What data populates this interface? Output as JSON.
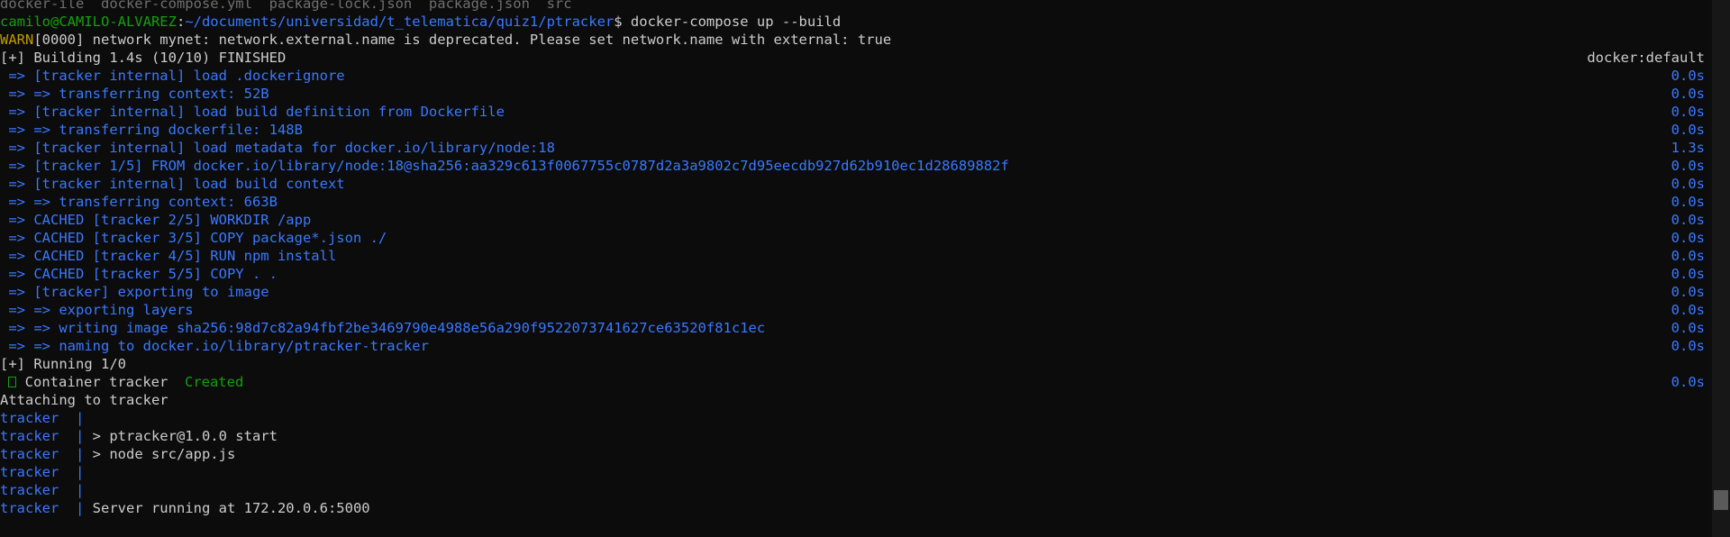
{
  "terminal": {
    "top_partial": "docker-ile  docker-compose.yml  package-lock.json  package.json  src",
    "prompt": {
      "user_host": "camilo@CAMILO-ALVAREZ",
      "path": "~/documents/universidad/t_telematica/quiz1/ptracker",
      "symbol": "$",
      "command": " docker-compose up --build"
    },
    "warn": {
      "label": "WARN",
      "message": "[0000] network mynet: network.external.name is deprecated. Please set network.name with external: true"
    },
    "building": {
      "text": "[+] Building 1.4s (10/10) FINISHED",
      "right": "docker:default"
    },
    "steps": [
      {
        "text": " => [tracker internal] load .dockerignore",
        "time": "0.0s"
      },
      {
        "text": " => => transferring context: 52B",
        "time": "0.0s"
      },
      {
        "text": " => [tracker internal] load build definition from Dockerfile",
        "time": "0.0s"
      },
      {
        "text": " => => transferring dockerfile: 148B",
        "time": "0.0s"
      },
      {
        "text": " => [tracker internal] load metadata for docker.io/library/node:18",
        "time": "1.3s"
      },
      {
        "text": " => [tracker 1/5] FROM docker.io/library/node:18@sha256:aa329c613f0067755c0787d2a3a9802c7d95eecdb927d62b910ec1d28689882f",
        "time": "0.0s"
      },
      {
        "text": " => [tracker internal] load build context",
        "time": "0.0s"
      },
      {
        "text": " => => transferring context: 663B",
        "time": "0.0s"
      },
      {
        "text": " => CACHED [tracker 2/5] WORKDIR /app",
        "time": "0.0s"
      },
      {
        "text": " => CACHED [tracker 3/5] COPY package*.json ./",
        "time": "0.0s"
      },
      {
        "text": " => CACHED [tracker 4/5] RUN npm install",
        "time": "0.0s"
      },
      {
        "text": " => CACHED [tracker 5/5] COPY . .",
        "time": "0.0s"
      },
      {
        "text": " => [tracker] exporting to image",
        "time": "0.0s"
      },
      {
        "text": " => => exporting layers",
        "time": "0.0s"
      },
      {
        "text": " => => writing image sha256:98d7c82a94fbf2be3469790e4988e56a290f9522073741627ce63520f81c1ec",
        "time": "0.0s"
      },
      {
        "text": " => => naming to docker.io/library/ptracker-tracker",
        "time": "0.0s"
      }
    ],
    "running": "[+] Running 1/0",
    "container": {
      "prefix": " Container tracker  ",
      "status": "Created",
      "time": "0.0s"
    },
    "attaching": "Attaching to tracker",
    "logs": [
      {
        "service": "tracker",
        "sep": "  | ",
        "msg": ""
      },
      {
        "service": "tracker",
        "sep": "  | ",
        "msg": "> ptracker@1.0.0 start"
      },
      {
        "service": "tracker",
        "sep": "  | ",
        "msg": "> node src/app.js"
      },
      {
        "service": "tracker",
        "sep": "  | ",
        "msg": ""
      },
      {
        "service": "tracker",
        "sep": "  | ",
        "msg": ""
      },
      {
        "service": "tracker",
        "sep": "  | ",
        "msg": "Server running at 172.20.0.6:5000"
      }
    ]
  }
}
